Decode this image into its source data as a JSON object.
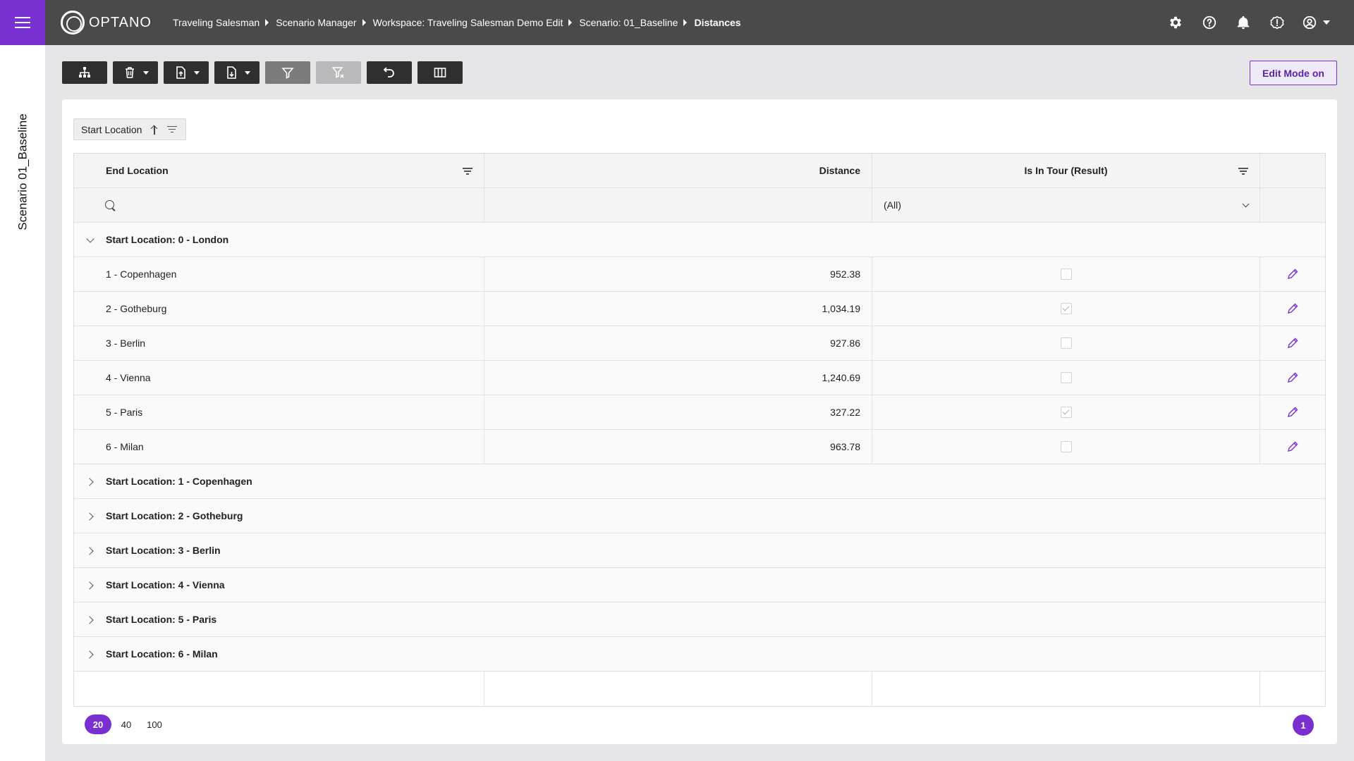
{
  "app": {
    "logo_text": "OPTANO"
  },
  "breadcrumb": [
    "Traveling Salesman",
    "Scenario Manager",
    "Workspace: Traveling Salesman Demo Edit",
    "Scenario: 01_Baseline",
    "Distances"
  ],
  "sidebar": {
    "vertical_title": "Scenario 01_Baseline"
  },
  "toolbar": {
    "edit_mode_label": "Edit Mode on"
  },
  "grouping": {
    "chip_label": "Start Location"
  },
  "table": {
    "columns": [
      "End Location",
      "Distance",
      "Is In Tour (Result)"
    ],
    "filter_select": "(All)",
    "expanded_group": {
      "label": "Start Location: 0 - London",
      "rows": [
        {
          "end": "1 - Copenhagen",
          "distance": "952.38",
          "in_tour": false
        },
        {
          "end": "2 - Gotheburg",
          "distance": "1,034.19",
          "in_tour": true
        },
        {
          "end": "3 - Berlin",
          "distance": "927.86",
          "in_tour": false
        },
        {
          "end": "4 - Vienna",
          "distance": "1,240.69",
          "in_tour": false
        },
        {
          "end": "5 - Paris",
          "distance": "327.22",
          "in_tour": true
        },
        {
          "end": "6 - Milan",
          "distance": "963.78",
          "in_tour": false
        }
      ]
    },
    "collapsed_groups": [
      "Start Location: 1 - Copenhagen",
      "Start Location: 2 - Gotheburg",
      "Start Location: 3 - Berlin",
      "Start Location: 4 - Vienna",
      "Start Location: 5 - Paris",
      "Start Location: 6 - Milan"
    ]
  },
  "pager": {
    "sizes": [
      "20",
      "40",
      "100"
    ],
    "selected_size": "20",
    "current_page": "1"
  },
  "colors": {
    "accent": "#7a2fd1",
    "topbar": "#4a4a4a"
  }
}
